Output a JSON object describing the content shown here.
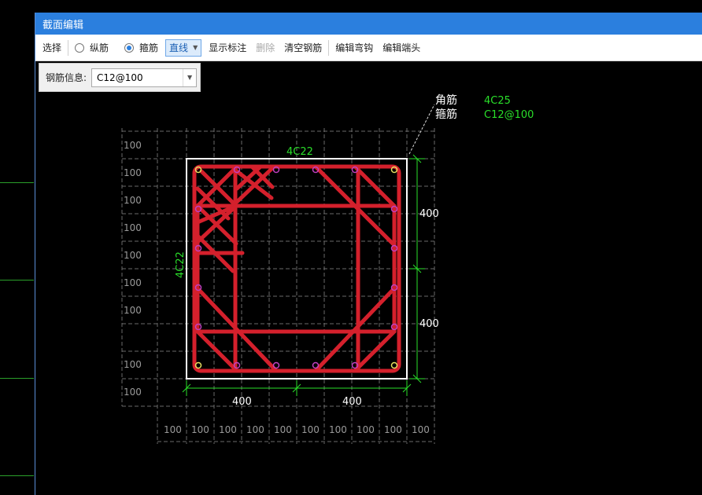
{
  "window": {
    "title": "截面编辑"
  },
  "toolbar": {
    "select": "选择",
    "longitudinal": "纵筋",
    "stirrup": "箍筋",
    "line_mode": "直线",
    "show_dims": "显示标注",
    "delete": "删除",
    "clear": "清空钢筋",
    "edit_hook": "编辑弯钩",
    "edit_end": "编辑端头"
  },
  "info": {
    "label": "钢筋信息:",
    "value": "C12@100"
  },
  "drawing": {
    "corner_label": "角筋",
    "corner_value": "4C25",
    "stirrup_label": "箍筋",
    "stirrup_value": "C12@100",
    "top_bars": "4C22",
    "side_bars": "4C22",
    "dim_right_top": "400",
    "dim_right_bottom": "400",
    "dim_bottom_left": "400",
    "dim_bottom_right": "400",
    "grid_left": [
      "100",
      "100",
      "100",
      "100",
      "100",
      "100",
      "100",
      "100",
      "100"
    ],
    "grid_bottom": [
      "100",
      "100",
      "100",
      "100",
      "100",
      "100",
      "100",
      "100",
      "100",
      "100"
    ],
    "colors": {
      "rebar": "#d4202c",
      "dim": "#2adf2a",
      "grid": "#6a6a6a",
      "outline": "#ffffff"
    }
  }
}
